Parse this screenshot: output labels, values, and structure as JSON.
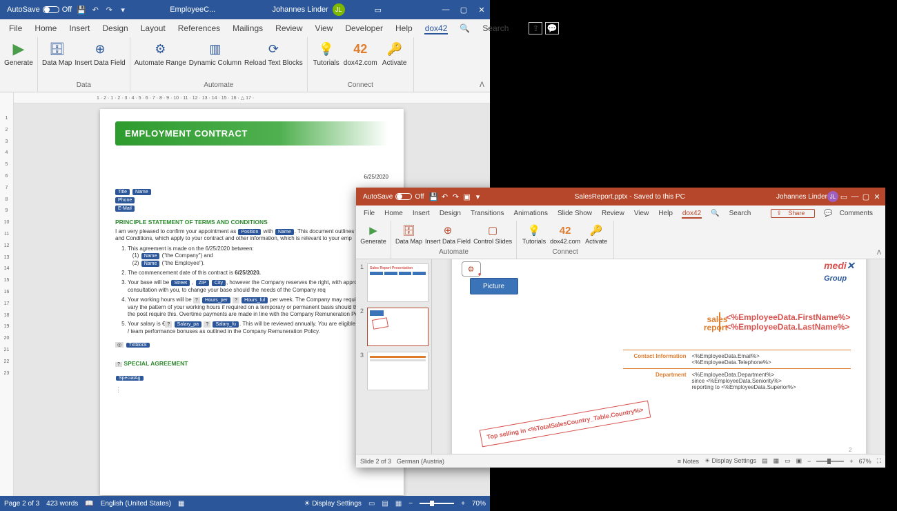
{
  "word": {
    "autosave": "AutoSave",
    "autosave_state": "Off",
    "doc_title": "EmployeeC...",
    "user": "Johannes Linder",
    "user_initials": "JL",
    "menu": {
      "file": "File",
      "home": "Home",
      "insert": "Insert",
      "design": "Design",
      "layout": "Layout",
      "references": "References",
      "mailings": "Mailings",
      "review": "Review",
      "view": "View",
      "developer": "Developer",
      "help": "Help",
      "dox42": "dox42",
      "search": "Search"
    },
    "ribbon": {
      "generate": "Generate",
      "data_map": "Data\nMap",
      "insert_df": "Insert\nData Field",
      "data_group": "Data",
      "automate_range": "Automate\nRange",
      "dynamic_col": "Dynamic\nColumn",
      "reload_tb": "Reload\nText Blocks",
      "automate_group": "Automate",
      "tutorials": "Tutorials",
      "dox42com": "dox42.com",
      "activate": "Activate",
      "connect_group": "Connect"
    },
    "ruler": "1 · 2 · 1 · 2 · 3 · 4 · 5 · 6 · 7 · 8 · 9 · 10 · 11 · 12 · 13 · 14 · 15 · 16 · △ 17 ·",
    "doc": {
      "header": "EMPLOYMENT CONTRACT",
      "date": "6/25/2020",
      "title_lbl": "Title",
      "name_lbl": "Name",
      "phone_lbl": "Phone",
      "email_lbl": "E-Mail",
      "sec1": "Principle Statement of Terms and Conditions",
      "intro_a": "I am very pleased to confirm your appointment as",
      "intro_b": "with",
      "intro_c": ". This document outlines the Terms and Conditions, which apply to your contract and other information, which is relevant to your emp",
      "li1": "This agreement is made on the 6/25/2020 between:",
      "li1a": "(1)",
      "li1a_txt": " (\"the Company\") and",
      "li1b": "(2)",
      "li1b_txt": " (\"the Employee\").",
      "li2": "The commencement date of this contract is ",
      "li2_date": "6/25/2020.",
      "li3": "Your base will be ",
      "li3_txt": ", however the Company reserves the right, with appropriate consultation with you, to change your base should the needs of the Company req",
      "li4": "Your working hours will be ",
      "li4_txt": " per week. The Company may require you to vary the pattern of your working hours if required on a temporary or permanent basis should the needs of the post require this. Overtime payments are made in line with the Company Remuneration Policy.",
      "li5": "Your salary is €",
      "li5_txt": ". This will be reviewed annually. You are eligible for individual / team performance bonuses as outlined in the Company Remuneration Policy.",
      "sec2": "Special Agreement",
      "specialag": "SpecialAg",
      "position": "Position",
      "name": "Name",
      "street": "Street",
      "zip": "ZIP",
      "city": "City",
      "hours_per": "Hours_per",
      "hours_full": "Hours_ful",
      "salary_pa": "Salary_pa",
      "salary_fu": "Salary_fu",
      "txtblock": "Txtblock"
    },
    "status": {
      "page": "Page 2 of 3",
      "words": "423 words",
      "lang": "English (United States)",
      "display": "Display Settings",
      "zoom": "70%"
    }
  },
  "pp": {
    "autosave": "AutoSave",
    "autosave_state": "Off",
    "doc_title": "SalesReport.pptx - Saved to this PC",
    "user": "Johannes Linder",
    "user_initials": "JL",
    "menu": {
      "file": "File",
      "home": "Home",
      "insert": "Insert",
      "design": "Design",
      "transitions": "Transitions",
      "animations": "Animations",
      "slideshow": "Slide Show",
      "review": "Review",
      "view": "View",
      "help": "Help",
      "dox42": "dox42",
      "search": "Search",
      "share": "Share",
      "comments": "Comments"
    },
    "ribbon": {
      "generate": "Generate",
      "data_map": "Data\nMap",
      "insert_df": "Insert\nData Field",
      "control_slides": "Control\nSlides",
      "automate_group": "Automate",
      "tutorials": "Tutorials",
      "dox42com": "dox42.com",
      "activate": "Activate",
      "connect_group": "Connect"
    },
    "slide": {
      "picture": "Picture",
      "logo1": "medi",
      "logo2": "Group",
      "sales": "sales",
      "report": "report",
      "firstname": "<%EmployeeData.FirstName%>",
      "lastname": "<%EmployeeData.LastName%>",
      "contact_k": "Contact Information",
      "contact_v1": "<%EmployeeData.Email%>",
      "contact_v2": "<%EmployeeData.Telephone%>",
      "dept_k": "Department",
      "dept_v1": "<%EmployeeData.Department%>",
      "dept_v2": "since <%EmployeeData.Seniority%>",
      "dept_v3": "reporting to <%EmployeeData.Superior%>",
      "stamp": "Top selling in <%TotalSalesCountry_Table.Country%>",
      "pgnum": "2"
    },
    "thumbs": {
      "n1": "1",
      "n2": "2",
      "n3": "3",
      "t1": "Sales Report Presentation"
    },
    "status": {
      "slide": "Slide 2 of 3",
      "lang": "German (Austria)",
      "notes": "Notes",
      "display": "Display Settings",
      "zoom": "67%"
    }
  }
}
